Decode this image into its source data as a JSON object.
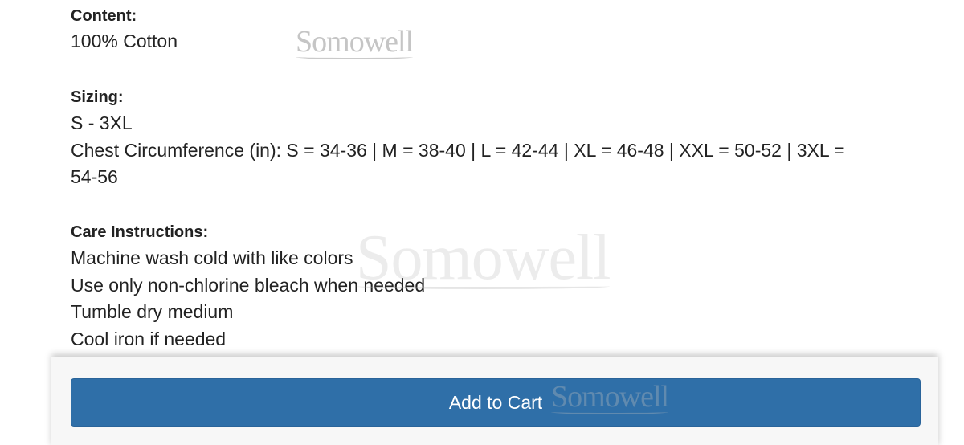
{
  "product_details": {
    "content": {
      "heading": "Content:",
      "lines": [
        "100% Cotton"
      ]
    },
    "sizing": {
      "heading": "Sizing:",
      "lines": [
        "S - 3XL",
        "Chest Circumference (in): S = 34-36 | M = 38-40 | L = 42-44 | XL = 46-48 | XXL = 50-52 | 3XL =",
        "54-56"
      ]
    },
    "care": {
      "heading": "Care Instructions:",
      "lines": [
        "Machine wash cold with like colors",
        "Use only non-chlorine bleach when needed",
        "Tumble dry medium",
        "Cool iron if needed"
      ]
    }
  },
  "watermark": {
    "text": "Somowell"
  },
  "cart": {
    "add_to_cart_label": "Add to Cart",
    "button_color": "#2f6fa8"
  }
}
